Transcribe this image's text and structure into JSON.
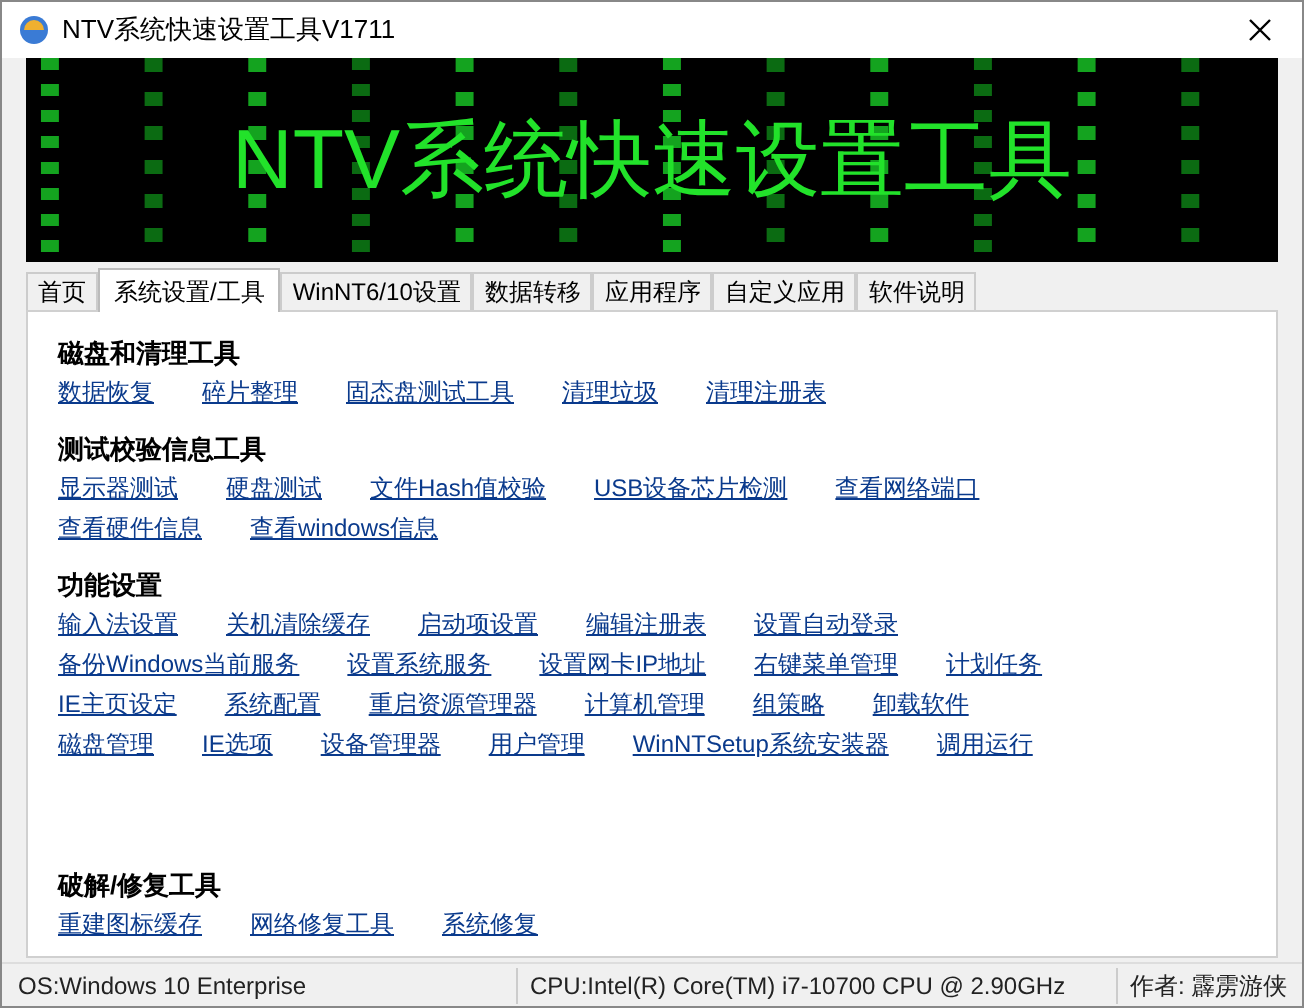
{
  "window": {
    "title": "NTV系统快速设置工具V1711"
  },
  "banner": {
    "kind": "picture",
    "title": "NTV系统快速设置工具"
  },
  "tabs": [
    {
      "label": "首页",
      "selected": false
    },
    {
      "label": "系统设置/工具",
      "selected": true
    },
    {
      "label": "WinNT6/10设置",
      "selected": false
    },
    {
      "label": "数据转移",
      "selected": false
    },
    {
      "label": "应用程序",
      "selected": false
    },
    {
      "label": "自定义应用",
      "selected": false
    },
    {
      "label": "软件说明",
      "selected": false
    }
  ],
  "sections": [
    {
      "title": "磁盘和清理工具",
      "lines": [
        {
          "links": [
            "数据恢复",
            "碎片整理",
            "固态盘测试工具",
            "清理垃圾",
            "清理注册表"
          ]
        }
      ]
    },
    {
      "title": "测试校验信息工具",
      "lines": [
        {
          "links": [
            "显示器测试",
            "硬盘测试",
            "文件Hash值校验",
            "USB设备芯片检测",
            "查看网络端口"
          ]
        },
        {
          "links": [
            "查看硬件信息",
            "查看windows信息"
          ]
        }
      ]
    },
    {
      "title": "功能设置",
      "lines": [
        {
          "links": [
            "输入法设置",
            "关机清除缓存",
            "启动项设置",
            "编辑注册表",
            "设置自动登录"
          ]
        },
        {
          "links": [
            "备份Windows当前服务",
            "设置系统服务",
            "设置网卡IP地址",
            "右键菜单管理",
            "计划任务"
          ]
        },
        {
          "links": [
            "IE主页设定",
            "系统配置",
            "重启资源管理器",
            "计算机管理",
            "组策略",
            "卸载软件"
          ]
        },
        {
          "links": [
            "磁盘管理",
            "IE选项",
            "设备管理器",
            "用户管理",
            "WinNTSetup系统安装器",
            "调用运行"
          ]
        }
      ]
    },
    {
      "title": "破解/修复工具",
      "lines": [
        {
          "links": [
            "重建图标缓存",
            "网络修复工具",
            "系统修复"
          ]
        }
      ]
    }
  ],
  "status_bar": [
    "OS:Windows 10 Enterprise",
    "CPU:Intel(R) Core(TM) i7-10700 CPU @ 2.90GHz",
    "作者: 霹雳游侠"
  ]
}
